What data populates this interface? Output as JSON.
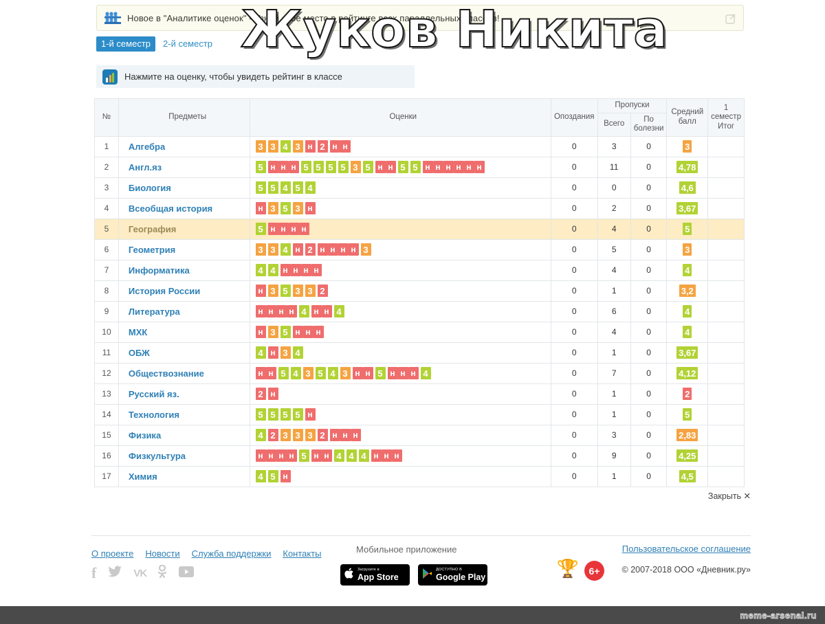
{
  "promo": {
    "text": "Новое в \"Аналитике оценок\" - Узнай свое место в рейтинге всех параллельных классов!",
    "icon": "people-group-icon",
    "close_icon": "external-close-icon"
  },
  "tabs": [
    {
      "label": "1-й семестр",
      "active": true
    },
    {
      "label": "2-й семестр",
      "active": false
    }
  ],
  "hint": {
    "icon": "analytics-bars-icon",
    "text": "Нажмите на оценку, чтобы увидеть рейтинг в классе"
  },
  "table": {
    "headers": {
      "num": "№",
      "subjects": "Предметы",
      "marks": "Оценки",
      "late": "Опоздания",
      "absences_group": "Пропуски",
      "absences_total": "Всего",
      "absences_illness": "По болезни",
      "average": "Средний балл",
      "final": "1 семестр Итог"
    },
    "rows": [
      {
        "num": "1",
        "subject": "Алгебра",
        "marks": [
          "3",
          "3",
          "4",
          "3",
          "н",
          "2",
          "н",
          "н"
        ],
        "late": "0",
        "total": "3",
        "illness": "0",
        "avg": "3",
        "final": ""
      },
      {
        "num": "2",
        "subject": "Англ.яз",
        "marks": [
          "5",
          "н",
          "н",
          "н",
          "5",
          "5",
          "5",
          "5",
          "3",
          "5",
          "н",
          "н",
          "5",
          "5",
          "н",
          "н",
          "н",
          "н",
          "н",
          "н"
        ],
        "late": "0",
        "total": "11",
        "illness": "0",
        "avg": "4,78",
        "final": ""
      },
      {
        "num": "3",
        "subject": "Биология",
        "marks": [
          "5",
          "5",
          "4",
          "5",
          "4"
        ],
        "late": "0",
        "total": "0",
        "illness": "0",
        "avg": "4,6",
        "final": ""
      },
      {
        "num": "4",
        "subject": "Всеобщая история",
        "marks": [
          "н",
          "3",
          "5",
          "3",
          "н"
        ],
        "late": "0",
        "total": "2",
        "illness": "0",
        "avg": "3,67",
        "final": ""
      },
      {
        "num": "5",
        "subject": "География",
        "marks": [
          "5",
          "н",
          "н",
          "н",
          "н"
        ],
        "late": "0",
        "total": "4",
        "illness": "0",
        "avg": "5",
        "final": "",
        "highlight": true
      },
      {
        "num": "6",
        "subject": "Геометрия",
        "marks": [
          "3",
          "3",
          "4",
          "н",
          "2",
          "н",
          "н",
          "н",
          "н",
          "3"
        ],
        "late": "0",
        "total": "5",
        "illness": "0",
        "avg": "3",
        "final": ""
      },
      {
        "num": "7",
        "subject": "Информатика",
        "marks": [
          "4",
          "4",
          "н",
          "н",
          "н",
          "н"
        ],
        "late": "0",
        "total": "4",
        "illness": "0",
        "avg": "4",
        "final": ""
      },
      {
        "num": "8",
        "subject": "История России",
        "marks": [
          "н",
          "3",
          "5",
          "3",
          "3",
          "2"
        ],
        "late": "0",
        "total": "1",
        "illness": "0",
        "avg": "3,2",
        "final": ""
      },
      {
        "num": "9",
        "subject": "Литература",
        "marks": [
          "н",
          "н",
          "н",
          "н",
          "4",
          "н",
          "н",
          "4"
        ],
        "late": "0",
        "total": "6",
        "illness": "0",
        "avg": "4",
        "final": ""
      },
      {
        "num": "10",
        "subject": "МХК",
        "marks": [
          "н",
          "3",
          "5",
          "н",
          "н",
          "н"
        ],
        "late": "0",
        "total": "4",
        "illness": "0",
        "avg": "4",
        "final": ""
      },
      {
        "num": "11",
        "subject": "ОБЖ",
        "marks": [
          "4",
          "н",
          "3",
          "4"
        ],
        "late": "0",
        "total": "1",
        "illness": "0",
        "avg": "3,67",
        "final": ""
      },
      {
        "num": "12",
        "subject": "Обществознание",
        "marks": [
          "н",
          "н",
          "5",
          "4",
          "3",
          "5",
          "4",
          "3",
          "н",
          "н",
          "5",
          "н",
          "н",
          "н",
          "4"
        ],
        "late": "0",
        "total": "7",
        "illness": "0",
        "avg": "4,12",
        "final": ""
      },
      {
        "num": "13",
        "subject": "Русский яз.",
        "marks": [
          "2",
          "н"
        ],
        "late": "0",
        "total": "1",
        "illness": "0",
        "avg": "2",
        "final": ""
      },
      {
        "num": "14",
        "subject": "Технология",
        "marks": [
          "5",
          "5",
          "5",
          "5",
          "н"
        ],
        "late": "0",
        "total": "1",
        "illness": "0",
        "avg": "5",
        "final": ""
      },
      {
        "num": "15",
        "subject": "Физика",
        "marks": [
          "4",
          "2",
          "3",
          "3",
          "3",
          "2",
          "н",
          "н",
          "н"
        ],
        "late": "0",
        "total": "3",
        "illness": "0",
        "avg": "2,83",
        "final": ""
      },
      {
        "num": "16",
        "subject": "Физкультура",
        "marks": [
          "н",
          "н",
          "н",
          "н",
          "5",
          "н",
          "н",
          "4",
          "4",
          "4",
          "н",
          "н",
          "н"
        ],
        "late": "0",
        "total": "9",
        "illness": "0",
        "avg": "4,25",
        "final": ""
      },
      {
        "num": "17",
        "subject": "Химия",
        "marks": [
          "4",
          "5",
          "н"
        ],
        "late": "0",
        "total": "1",
        "illness": "0",
        "avg": "4,5",
        "final": ""
      }
    ]
  },
  "close": {
    "label": "Закрыть ✕"
  },
  "footer": {
    "links": [
      {
        "label": "О проекте"
      },
      {
        "label": "Новости"
      },
      {
        "label": "Служба поддержки"
      },
      {
        "label": "Контакты"
      }
    ],
    "socials": [
      {
        "name": "facebook-icon",
        "glyph": "f"
      },
      {
        "name": "twitter-icon",
        "glyph": "🐦"
      },
      {
        "name": "vk-icon",
        "glyph": "VK"
      },
      {
        "name": "odnoklassniki-icon",
        "glyph": "OK"
      },
      {
        "name": "youtube-icon",
        "glyph": "▶"
      }
    ],
    "mobile_title": "Мобильное приложение",
    "stores": [
      {
        "small": "Загрузите в",
        "big": "App Store",
        "icon": "apple-icon"
      },
      {
        "small": "ДОСТУПНО В",
        "big": "Google Play",
        "icon": "google-play-icon"
      }
    ],
    "eula": "Пользовательское соглашение",
    "age_rating": "6+",
    "copyright": "© 2007-2018 ООО «Дневник.ру»",
    "runet_icon": "runet-award-icon"
  },
  "overlay": {
    "name": "Жуков Никита"
  },
  "watermark": {
    "text": "meme-arsenal.ru"
  }
}
